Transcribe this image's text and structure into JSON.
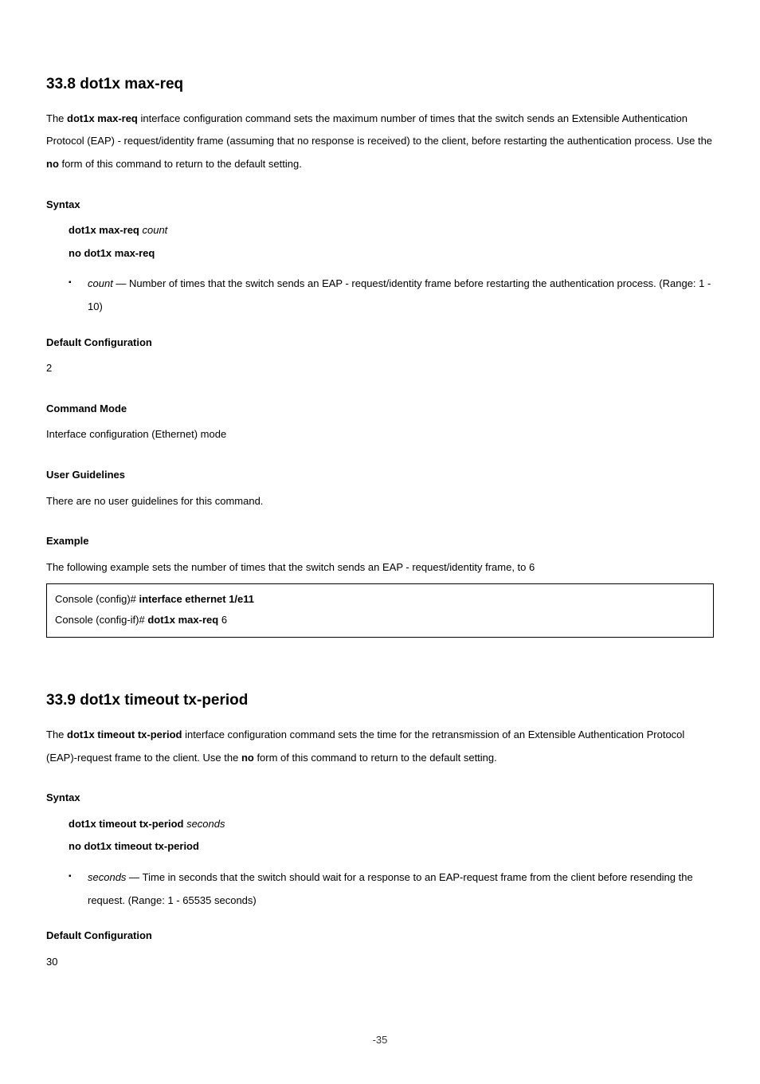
{
  "s1": {
    "heading": "33.8 dot1x max-req",
    "desc_1": "The ",
    "desc_bold1": "dot1x max-req",
    "desc_2": " interface configuration command sets the maximum number of times that the switch sends an Extensible Authentication Protocol (EAP) - request/identity frame (assuming that no response is received) to the client, before restarting the authentication process. Use the ",
    "desc_bold2": "no",
    "desc_3": " form of this command to return to the default setting.",
    "syntax_h": "Syntax",
    "syntax_l1_b": "dot1x max-req ",
    "syntax_l1_i": "count",
    "syntax_l2": "no dot1x max-req",
    "param_b": "count — ",
    "param_t": "Number of times that the switch sends an EAP - request/identity frame before restarting the authentication process. (Range: 1 - 10)",
    "def_h": "Default Configuration",
    "def_v": "2",
    "mode_h": "Command Mode",
    "mode_v": "Interface configuration (Ethernet) mode",
    "ug_h": "User Guidelines",
    "ug_v": "There are no user guidelines for this command.",
    "ex_h": "Example",
    "ex_v": "The following example sets the number of times that the switch sends an EAP - request/identity frame, to 6",
    "code_l1_a": "Console (config)# ",
    "code_l1_b": "interface ethernet 1/e11",
    "code_l2_a": "Console (config-if)# ",
    "code_l2_b": "dot1x max-req ",
    "code_l2_c": "6"
  },
  "s2": {
    "heading": "33.9 dot1x timeout tx-period",
    "desc_1": "The ",
    "desc_bold1": "dot1x timeout tx-period",
    "desc_2": " interface configuration command sets the time for the retransmission of an Extensible Authentication Protocol (EAP)-request frame to the client. Use the ",
    "desc_bold2": "no",
    "desc_3": " form of this command to return to the default setting.",
    "syntax_h": "Syntax",
    "syntax_l1_b": "dot1x timeout tx-period ",
    "syntax_l1_i": "seconds",
    "syntax_l2": "no dot1x timeout tx-period",
    "param_b": "seconds — ",
    "param_t": "Time in seconds that the switch should wait for a response to an EAP-request frame from the client before resending the request. (Range: 1 - 65535 seconds)",
    "def_h": "Default Configuration",
    "def_v": "30"
  },
  "page": "-35"
}
